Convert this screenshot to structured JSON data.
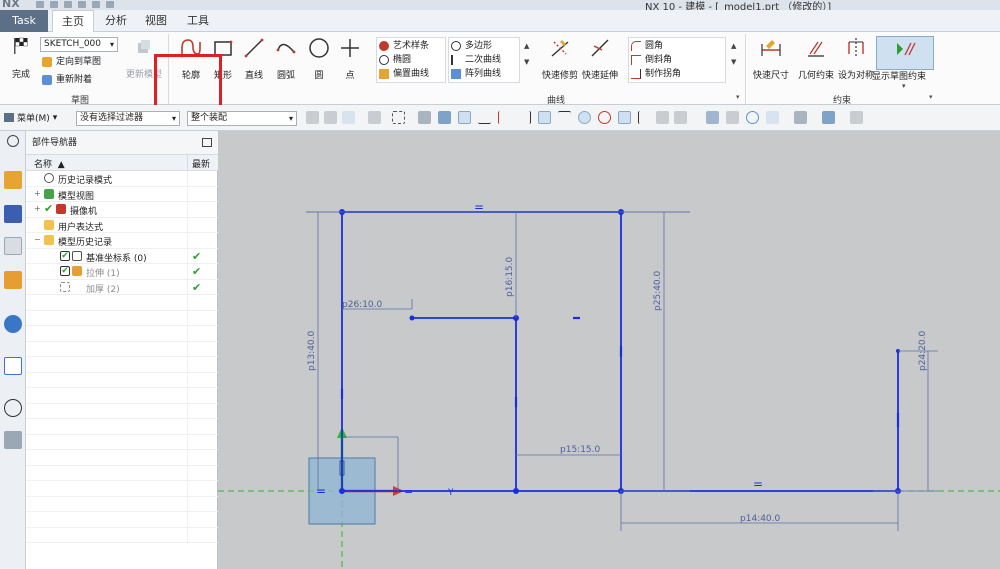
{
  "titlebar": {
    "logo": "NX",
    "title": "NX 10 - 建模 - [_model1.prt （修改的）]"
  },
  "tabs": {
    "task": "Task",
    "home": "主页",
    "analysis": "分析",
    "view": "视图",
    "tools": "工具"
  },
  "ribbon": {
    "finish_label": "完成",
    "sketch_name": "SKETCH_000",
    "orient_label": "定向到草图",
    "reattach_label": "重新附着",
    "update_model_label": "更新模型",
    "sketch_group_label": "草图",
    "curve_group_label": "曲线",
    "constraint_group_label": "约束",
    "tools": {
      "profile": "轮廓",
      "rectangle": "矩形",
      "line": "直线",
      "arc": "圆弧",
      "circle": "圆",
      "point": "点"
    },
    "curve_col1": [
      "艺术样条",
      "椭圆",
      "偏置曲线"
    ],
    "curve_col2": [
      "多边形",
      "二次曲线",
      "阵列曲线"
    ],
    "quick_trim": "快速修剪",
    "quick_extend": "快速延伸",
    "curve_col3": [
      "圆角",
      "倒斜角",
      "制作拐角"
    ],
    "quick_dimension": "快速尺寸",
    "geometric_constraint": "几何约束",
    "make_symmetric": "设为对称",
    "show_constraints": "显示草图约束"
  },
  "toolbar": {
    "menu_label": "菜单(M)",
    "filter_select": "没有选择过滤器",
    "assembly_select": "整个装配"
  },
  "navigator": {
    "title": "部件导航器",
    "col_name": "名称",
    "col_latest": "最新",
    "rows": [
      {
        "label": "历史记录模式",
        "indent": 0
      },
      {
        "label": "模型视图",
        "indent": 0
      },
      {
        "label": "摄像机",
        "indent": 0
      },
      {
        "label": "用户表达式",
        "indent": 0
      },
      {
        "label": "模型历史记录",
        "indent": 0
      },
      {
        "label": "基准坐标系 (0)",
        "indent": 1,
        "latest": "✔"
      },
      {
        "label": "拉伸 (1)",
        "indent": 1,
        "latest": "✔"
      },
      {
        "label": "加厚 (2)",
        "indent": 1,
        "latest": "✔"
      }
    ]
  },
  "canvas": {
    "dims": {
      "p13": "p13:40.0",
      "p16": "p16:15.0",
      "p25": "p25:40.0",
      "p26": "p26:10.0",
      "p15": "p15:15.0",
      "p14": "p14:40.0",
      "p24": "p24:20.0",
      "axis_y": "Y",
      "eq": "="
    }
  },
  "colors": {
    "sketch": "#1a2fdc",
    "dimension": "#4d5f9a",
    "accent_red": "#e02020",
    "axis_green": "#2fb82f"
  }
}
